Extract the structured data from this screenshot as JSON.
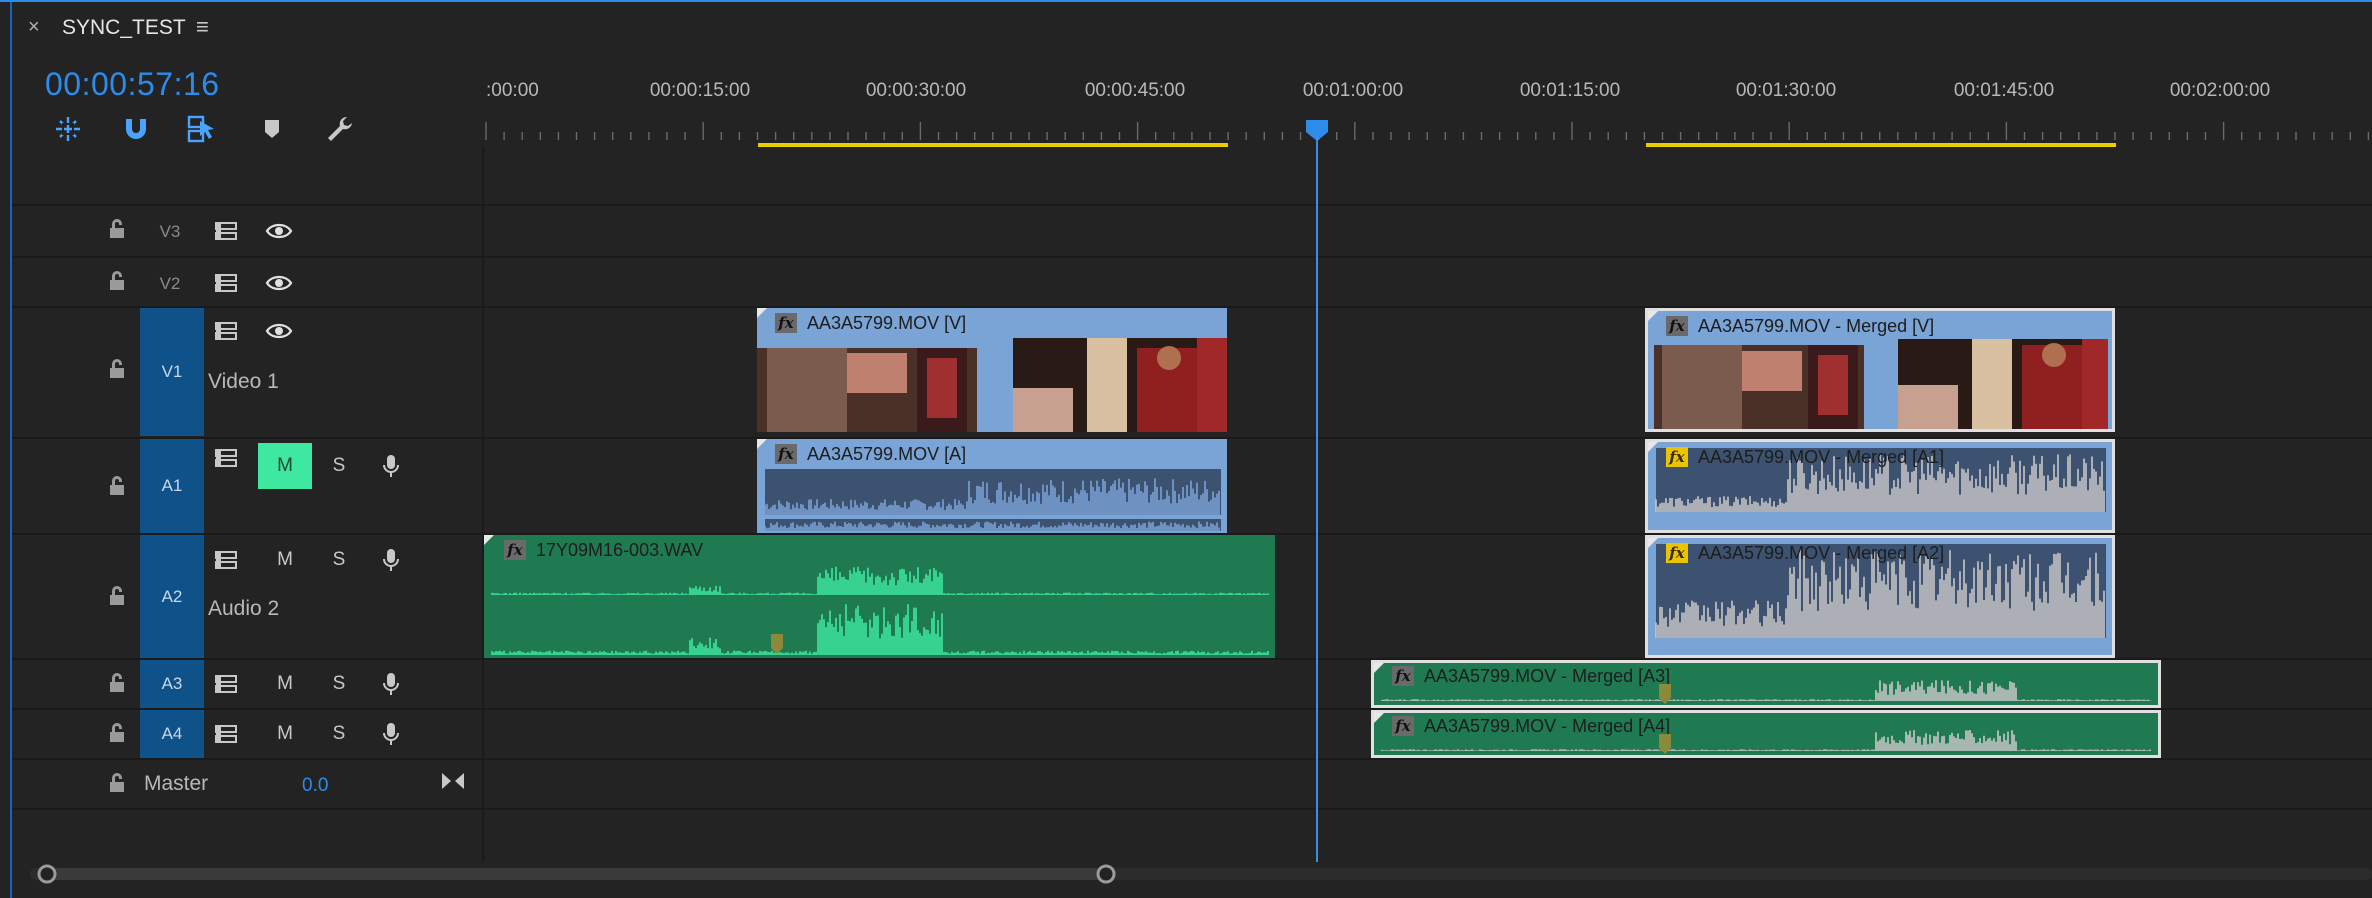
{
  "sequence": {
    "title": "SYNC_TEST",
    "close_label": "×",
    "menu_label": "≡"
  },
  "timecode": "00:00:57:16",
  "tools": [
    {
      "name": "insert-overwrite-icon"
    },
    {
      "name": "snap-magnet-icon"
    },
    {
      "name": "linked-selection-icon"
    },
    {
      "name": "add-marker-icon"
    },
    {
      "name": "wrench-settings-icon"
    }
  ],
  "ruler": {
    "labels": [
      ":00:00",
      "00:00:15:00",
      "00:00:30:00",
      "00:00:45:00",
      "00:01:00:00",
      "00:01:15:00",
      "00:01:30:00",
      "00:01:45:00",
      "00:02:00:00"
    ]
  },
  "tracks": {
    "v3": {
      "label": "V3"
    },
    "v2": {
      "label": "V2"
    },
    "v1": {
      "label": "V1",
      "name": "Video 1"
    },
    "a1": {
      "label": "A1",
      "m": "M",
      "s": "S"
    },
    "a2": {
      "label": "A2",
      "name": "Audio 2",
      "m": "M",
      "s": "S"
    },
    "a3": {
      "label": "A3",
      "m": "M",
      "s": "S"
    },
    "a4": {
      "label": "A4",
      "m": "M",
      "s": "S"
    },
    "master": {
      "label": "Master",
      "value": "0.0"
    }
  },
  "clips": {
    "v1a": "AA3A5799.MOV [V]",
    "v1b": "AA3A5799.MOV - Merged [V]",
    "a1a": "AA3A5799.MOV [A]",
    "a1b": "AA3A5799.MOV - Merged [A1]",
    "a2a": "17Y09M16-003.WAV",
    "a2b": "AA3A5799.MOV - Merged [A2]",
    "a3": "AA3A5799.MOV - Merged [A3]",
    "a4": "AA3A5799.MOV - Merged [A4]",
    "fx_label": "fx"
  },
  "colors": {
    "accent": "#2d8ceb",
    "video_clip": "#7aa3d6",
    "audio_clip_blue": "#7aa3d6",
    "audio_clip_green": "#1f7a52",
    "waveform_green": "#3ee8a0",
    "waveform_grey": "#c8c8c8",
    "in_out_bar": "#e8d000"
  }
}
